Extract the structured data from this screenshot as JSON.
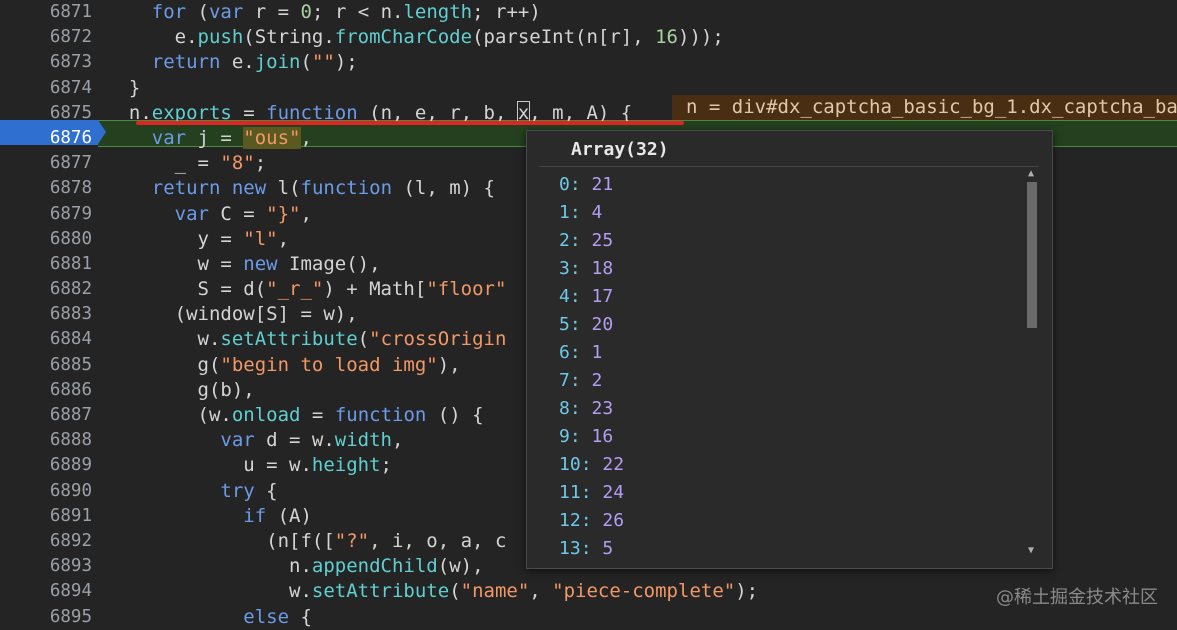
{
  "editor": {
    "lines": [
      {
        "num": "6871"
      },
      {
        "num": "6872"
      },
      {
        "num": "6873"
      },
      {
        "num": "6874"
      },
      {
        "num": "6875"
      },
      {
        "num": "6876"
      },
      {
        "num": "6877"
      },
      {
        "num": "6878"
      },
      {
        "num": "6879"
      },
      {
        "num": "6880"
      },
      {
        "num": "6881"
      },
      {
        "num": "6882"
      },
      {
        "num": "6883"
      },
      {
        "num": "6884"
      },
      {
        "num": "6885"
      },
      {
        "num": "6886"
      },
      {
        "num": "6887"
      },
      {
        "num": "6888"
      },
      {
        "num": "6889"
      },
      {
        "num": "6890"
      },
      {
        "num": "6891"
      },
      {
        "num": "6892"
      },
      {
        "num": "6893"
      },
      {
        "num": "6894"
      },
      {
        "num": "6895"
      }
    ],
    "inline_value": "n = div#dx_captcha_basic_bg_1.dx_captcha_ba"
  },
  "popup": {
    "title": "Array(32)",
    "items": [
      {
        "key": "0",
        "value": "21"
      },
      {
        "key": "1",
        "value": "4"
      },
      {
        "key": "2",
        "value": "25"
      },
      {
        "key": "3",
        "value": "18"
      },
      {
        "key": "4",
        "value": "17"
      },
      {
        "key": "5",
        "value": "20"
      },
      {
        "key": "6",
        "value": "1"
      },
      {
        "key": "7",
        "value": "2"
      },
      {
        "key": "8",
        "value": "23"
      },
      {
        "key": "9",
        "value": "16"
      },
      {
        "key": "10",
        "value": "22"
      },
      {
        "key": "11",
        "value": "24"
      },
      {
        "key": "12",
        "value": "26"
      },
      {
        "key": "13",
        "value": "5"
      }
    ]
  },
  "watermark": "@稀土掘金技术社区"
}
